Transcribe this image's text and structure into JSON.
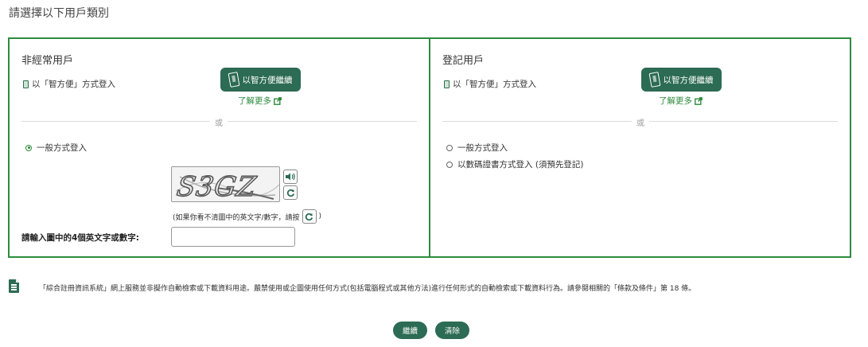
{
  "page": {
    "title": "請選擇以下用戶類別"
  },
  "left_panel": {
    "title": "非經常用戶",
    "iam_login_text": "以「智方便」方式登入",
    "iam_button_label": "以智方便繼續",
    "learn_more": "了解更多",
    "divider_label": "或",
    "general_login_label": "一般方式登入",
    "captcha_text": "S3GZ",
    "captcha_hint_prefix": "(如果你看不清圖中的英文字/數字，請按",
    "captcha_hint_suffix": ")",
    "captcha_input_label": "請輸入圖中的4個英文字或數字:",
    "captcha_input_value": ""
  },
  "right_panel": {
    "title": "登記用戶",
    "iam_login_text": "以「智方便」方式登入",
    "iam_button_label": "以智方便繼續",
    "learn_more": "了解更多",
    "divider_label": "或",
    "general_login_label": "一般方式登入",
    "cert_login_label": "以數碼證書方式登入 (須預先登記)"
  },
  "notice": {
    "text": "「綜合註冊資訊系統」網上服務並非擬作自動檢索或下載資料用途。嚴禁使用或企圖使用任何方式(包括電腦程式或其他方法)進行任何形式的自動檢索或下載資料行為。請參閱相關的「條款及條件」第 18 條。"
  },
  "actions": {
    "continue_label": "繼續",
    "clear_label": "清除"
  },
  "colors": {
    "border_green": "#2e8b3e",
    "button_green": "#2c6b54"
  },
  "icons": [
    "phone-icon",
    "external-link-icon",
    "speaker-icon",
    "refresh-icon",
    "document-icon"
  ]
}
